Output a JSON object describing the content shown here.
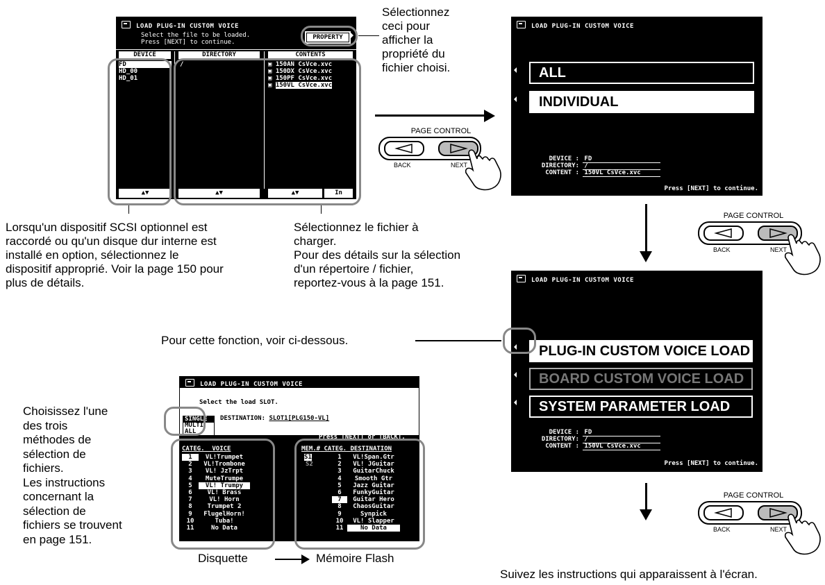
{
  "screen1": {
    "title": "LOAD PLUG-IN CUSTOM VOICE",
    "line1": "Select the file to be loaded.",
    "line2": "Press [NEXT] to continue.",
    "property_button": "PROPERTY",
    "columns": [
      "DEVICE",
      "DIRECTORY",
      "CONTENTS"
    ],
    "devices": [
      "FD",
      "HD_00",
      "HD_01"
    ],
    "directories": [
      "/"
    ],
    "contents": [
      "150AN CsVce.xvc",
      "150DX CsVce.xvc",
      "150PF CsVce.xvc",
      "150VL CsVce.xvc"
    ],
    "bottom": [
      "▲▼",
      "▲▼",
      "▲▼",
      "In"
    ]
  },
  "screen2": {
    "title": "LOAD PLUG-IN CUSTOM VOICE",
    "options": [
      "ALL",
      "INDIVIDUAL"
    ],
    "device_label": "DEVICE :",
    "device_value": "FD",
    "directory_label": "DIRECTORY:",
    "directory_value": "/",
    "content_label": "CONTENT :",
    "content_value": "150VL CsVce.xvc",
    "footer": "Press [NEXT] to continue."
  },
  "screen3": {
    "title": "LOAD PLUG-IN CUSTOM VOICE",
    "options": [
      "PLUG-IN CUSTOM VOICE LOAD",
      "BOARD CUSTOM VOICE LOAD",
      "SYSTEM PARAMETER LOAD"
    ],
    "device_label": "DEVICE :",
    "device_value": "FD",
    "directory_label": "DIRECTORY:",
    "directory_value": "/",
    "content_label": "CONTENT :",
    "content_value": "150VL CsVce.xvc",
    "footer": "Press [NEXT] to continue."
  },
  "screen4": {
    "title": "LOAD PLUG-IN CUSTOM VOICE",
    "line1": "Select the load SLOT.",
    "modes": [
      "SINGLE",
      "MULTI",
      "ALL"
    ],
    "destination_label": "DESTINATION:",
    "destination_value": "SLOT1[PLG150-VL]",
    "press_line": "Press [NEXT] or [BACK].",
    "left_headers": [
      "CATEG.",
      "VOICE"
    ],
    "left_rows": [
      [
        "1",
        "VL!Trumpet"
      ],
      [
        "2",
        "VL!Trombone"
      ],
      [
        "3",
        "VL! JzTrpt"
      ],
      [
        "4",
        "MuteTrumpe"
      ],
      [
        "5",
        "VL! Trumpy"
      ],
      [
        "6",
        "VL! Brass"
      ],
      [
        "7",
        "VL! Horn"
      ],
      [
        "8",
        "Trumpet 2"
      ],
      [
        "9",
        "FlugelHorn!"
      ],
      [
        "10",
        "Tuba!"
      ],
      [
        "11",
        "No Data"
      ]
    ],
    "right_headers": [
      "MEM.#",
      "CATEG.",
      "DESTINATION"
    ],
    "mem": [
      "S1",
      "S2"
    ],
    "right_rows": [
      [
        "1",
        "VL!Span.Gtr"
      ],
      [
        "2",
        "VL! JGuitar"
      ],
      [
        "3",
        "GuitarChuck"
      ],
      [
        "4",
        "Smooth Gtr"
      ],
      [
        "5",
        "Jazz Guitar"
      ],
      [
        "6",
        "FunkyGuitar"
      ],
      [
        "7",
        "Guitar Hero"
      ],
      [
        "8",
        "ChaosGuitar"
      ],
      [
        "9",
        "Synpick"
      ],
      [
        "10",
        "VL! Slapper"
      ],
      [
        "11",
        "No Data"
      ]
    ]
  },
  "page_control": {
    "title": "PAGE CONTROL",
    "back": "BACK",
    "next": "NEXT"
  },
  "captions": {
    "property": "Sélectionnez\nceci pour\nafficher la\npropriété du\nfichier choisi.",
    "device": "Lorsqu'un dispositif SCSI optionnel est\nraccordé ou qu'un disque dur interne est\ninstallé en option, sélectionnez le\ndispositif approprié. Voir la page 150 pour\nplus de détails.",
    "file": "Sélectionnez le fichier à\ncharger.\nPour des détails sur la sélection\nd'un répertoire / fichier,\nreportez-vous à la page 151.",
    "function": "Pour cette fonction, voir ci-dessous.",
    "methods": "Choisissez l'une\ndes trois\nméthodes de\nsélection de\nfichiers.\nLes instructions\nconcernant la\nsélection de\nfichiers se trouvent\nen page 151.",
    "disk": "Disquette",
    "flash": "Mémoire Flash",
    "follow": "Suivez les instructions qui apparaissent à l'écran."
  }
}
